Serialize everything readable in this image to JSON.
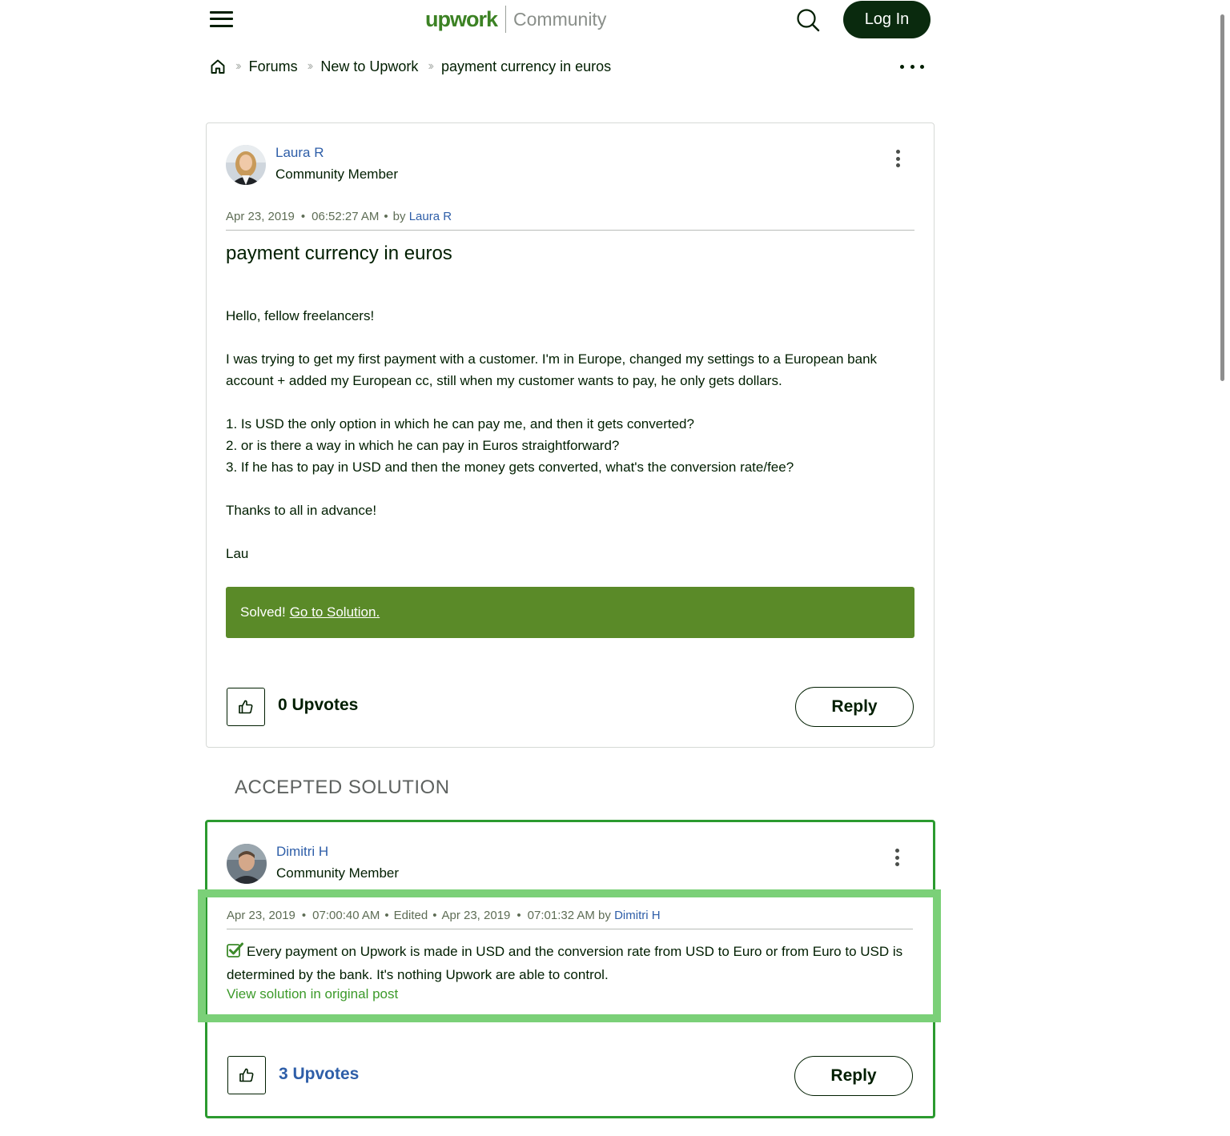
{
  "header": {
    "logo_brand": "upwork",
    "logo_section": "Community",
    "login_label": "Log In"
  },
  "breadcrumb": {
    "items": [
      "Forums",
      "New to Upwork",
      "payment currency in euros"
    ]
  },
  "post": {
    "author_name": "Laura R",
    "author_role": "Community Member",
    "date": "Apr 23, 2019",
    "time": "06:52:27 AM",
    "by_prefix": "by",
    "by_author": "Laura R",
    "title": "payment currency in euros",
    "body": [
      "Hello, fellow freelancers!",
      "I was trying to get my first payment with a customer. I'm in Europe, changed my settings to a European bank account + added my European cc, still when my customer wants to pay, he only gets dollars.",
      "1. Is USD the only option in which he can pay me, and then it gets converted?",
      "2. or is there a way in which he can pay in Euros straightforward?",
      "3. If he has to pay in USD and then the money gets converted, what's the conversion rate/fee?",
      "Thanks to all in advance!",
      "Lau"
    ],
    "solved_label": "Solved!",
    "solved_link": "Go to Solution.",
    "upvotes": "0 Upvotes",
    "reply_label": "Reply"
  },
  "solution": {
    "heading": "ACCEPTED SOLUTION",
    "author_name": "Dimitri H",
    "author_role": "Community Member",
    "date": "Apr 23, 2019",
    "time": "07:00:40 AM",
    "edited_label": "Edited",
    "edited_date": "Apr 23, 2019",
    "edited_time_by": "07:01:32 AM by",
    "by_author": "Dimitri H",
    "body": "Every payment on Upwork is made in USD and the conversion rate from USD to Euro or from Euro to USD is determined by the bank. It's nothing Upwork are able to control.",
    "view_link": "View solution in original post",
    "upvotes": "3 Upvotes",
    "reply_label": "Reply"
  },
  "colors": {
    "brand_green": "#3c8224",
    "solved_banner": "#5a8a28",
    "solution_border": "#2b9a2f",
    "highlight": "#7bd078",
    "link_blue": "#2e5ea8",
    "dark": "#001e00"
  },
  "icons": {
    "menu": "hamburger-menu-icon",
    "search": "search-icon",
    "home": "home-icon",
    "more": "more-horizontal-icon",
    "options": "more-vertical-icon",
    "thumbs_up": "thumbs-up-icon",
    "checkbox": "checked-box-icon"
  }
}
